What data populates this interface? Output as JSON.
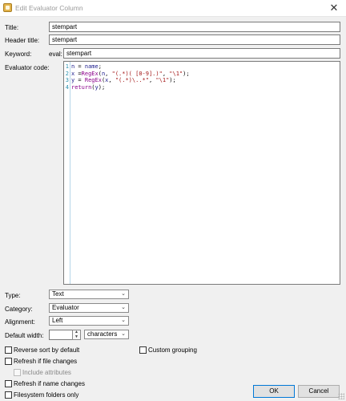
{
  "window": {
    "title": "Edit Evaluator Column",
    "close_glyph": "✕",
    "icon": "app-icon"
  },
  "form": {
    "title_label": "Title:",
    "title_value": "stempart",
    "header_label": "Header title:",
    "header_value": "stempart",
    "keyword_label": "Keyword:",
    "keyword_prefix": "eval:",
    "keyword_value": "stempart",
    "code_label": "Evaluator code:"
  },
  "code": {
    "line_numbers": [
      "1",
      "2",
      "3",
      "4"
    ],
    "lines": [
      [
        {
          "t": "n",
          "c": "id"
        },
        {
          "t": " = ",
          "c": "op"
        },
        {
          "t": "name",
          "c": "id"
        },
        {
          "t": ";",
          "c": "op"
        }
      ],
      [
        {
          "t": "x",
          "c": "id"
        },
        {
          "t": " =",
          "c": "op"
        },
        {
          "t": "RegEx",
          "c": "fn"
        },
        {
          "t": "(",
          "c": "op"
        },
        {
          "t": "n",
          "c": "id"
        },
        {
          "t": ", ",
          "c": "op"
        },
        {
          "t": "\"(.*)( [0-9].)\"",
          "c": "str"
        },
        {
          "t": ", ",
          "c": "op"
        },
        {
          "t": "\"\\1\"",
          "c": "str"
        },
        {
          "t": ");",
          "c": "op"
        }
      ],
      [
        {
          "t": "y",
          "c": "id"
        },
        {
          "t": " = ",
          "c": "op"
        },
        {
          "t": "RegEx",
          "c": "fn"
        },
        {
          "t": "(",
          "c": "op"
        },
        {
          "t": "x",
          "c": "id"
        },
        {
          "t": ", ",
          "c": "op"
        },
        {
          "t": "\"(.*)\\..*\"",
          "c": "str"
        },
        {
          "t": ", ",
          "c": "op"
        },
        {
          "t": "\"\\1\"",
          "c": "str"
        },
        {
          "t": ");",
          "c": "op"
        }
      ],
      [
        {
          "t": "return",
          "c": "fn"
        },
        {
          "t": "(",
          "c": "op"
        },
        {
          "t": "y",
          "c": "id"
        },
        {
          "t": ");",
          "c": "op"
        }
      ]
    ],
    "colors": {
      "id": "#1a1a8c",
      "str": "#a31515",
      "fn": "#8b008b",
      "op": "#000000"
    }
  },
  "options": {
    "type_label": "Type:",
    "type_value": "Text",
    "category_label": "Category:",
    "category_value": "Evaluator",
    "alignment_label": "Alignment:",
    "alignment_value": "Left",
    "width_label": "Default width:",
    "width_value": "",
    "width_unit": "characters"
  },
  "checks": {
    "reverse_sort": {
      "label": "Reverse sort by default",
      "checked": false
    },
    "custom_grouping": {
      "label": "Custom grouping",
      "checked": false
    },
    "refresh_file": {
      "label": "Refresh if file changes",
      "checked": false
    },
    "include_attributes": {
      "label": "Include attributes",
      "checked": false,
      "disabled": true
    },
    "refresh_name": {
      "label": "Refresh if name changes",
      "checked": false
    },
    "filesystem_only": {
      "label": "Filesystem folders only",
      "checked": false
    }
  },
  "buttons": {
    "ok": "OK",
    "cancel": "Cancel"
  },
  "glyphs": {
    "dropdown": "⌄",
    "spin_up": "▲",
    "spin_down": "▼"
  }
}
